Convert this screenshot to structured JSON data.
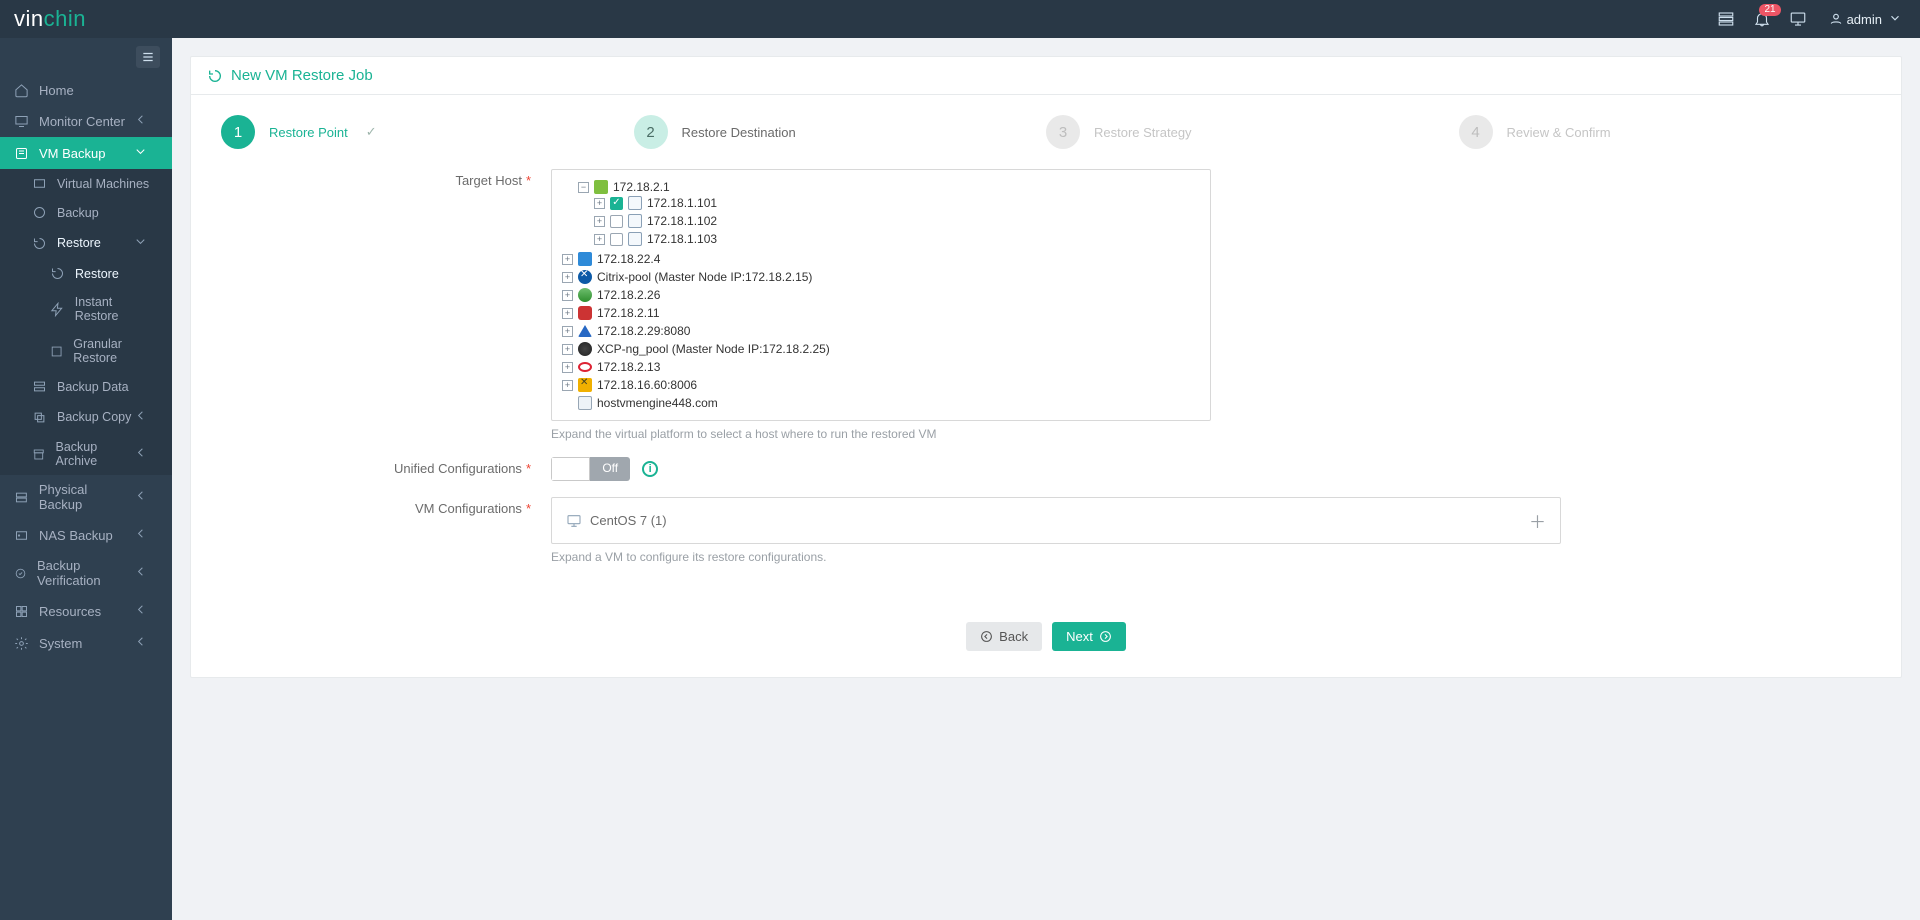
{
  "brand": {
    "a": "vin",
    "b": "chin"
  },
  "topbar": {
    "notif_count": "21",
    "user": "admin"
  },
  "sidebar": {
    "items": [
      {
        "label": "Home"
      },
      {
        "label": "Monitor Center"
      },
      {
        "label": "VM Backup"
      },
      {
        "label": "Physical Backup"
      },
      {
        "label": "NAS Backup"
      },
      {
        "label": "Backup Verification"
      },
      {
        "label": "Resources"
      },
      {
        "label": "System"
      }
    ],
    "vmbackup_children": [
      {
        "label": "Virtual Machines"
      },
      {
        "label": "Backup"
      },
      {
        "label": "Restore"
      },
      {
        "label": "Backup Data"
      },
      {
        "label": "Backup Copy"
      },
      {
        "label": "Backup Archive"
      }
    ],
    "restore_children": [
      {
        "label": "Restore"
      },
      {
        "label": "Instant Restore"
      },
      {
        "label": "Granular Restore"
      }
    ]
  },
  "page": {
    "title": "New VM Restore Job",
    "steps": [
      {
        "num": "1",
        "label": "Restore Point"
      },
      {
        "num": "2",
        "label": "Restore Destination"
      },
      {
        "num": "3",
        "label": "Restore Strategy"
      },
      {
        "num": "4",
        "label": "Review & Confirm"
      }
    ],
    "target_host_label": "Target Host",
    "target_hint": "Expand the virtual platform to select a host where to run the restored VM",
    "tree": {
      "root": "172.18.2.1",
      "hosts": [
        {
          "ip": "172.18.1.101",
          "checked": true
        },
        {
          "ip": "172.18.1.102",
          "checked": false
        },
        {
          "ip": "172.18.1.103",
          "checked": false
        }
      ],
      "platforms": [
        {
          "label": "172.18.22.4",
          "icon": "ic-win"
        },
        {
          "label": "Citrix-pool (Master Node IP:172.18.2.15)",
          "icon": "ic-citrix"
        },
        {
          "label": "172.18.2.26",
          "icon": "ic-green"
        },
        {
          "label": "172.18.2.11",
          "icon": "ic-red"
        },
        {
          "label": "172.18.2.29:8080",
          "icon": "ic-tri"
        },
        {
          "label": "XCP-ng_pool (Master Node IP:172.18.2.25)",
          "icon": "ic-xcp"
        },
        {
          "label": "172.18.2.13",
          "icon": "ic-oval"
        },
        {
          "label": "172.18.16.60:8006",
          "icon": "ic-x"
        },
        {
          "label": "hostvmengine448.com",
          "icon": "ic-disk"
        }
      ]
    },
    "unified_label": "Unified Configurations",
    "unified_value": "Off",
    "vmconf_label": "VM Configurations",
    "vmconf_item": "CentOS 7 (1)",
    "vmconf_hint": "Expand a VM to configure its restore configurations.",
    "back": "Back",
    "next": "Next"
  }
}
